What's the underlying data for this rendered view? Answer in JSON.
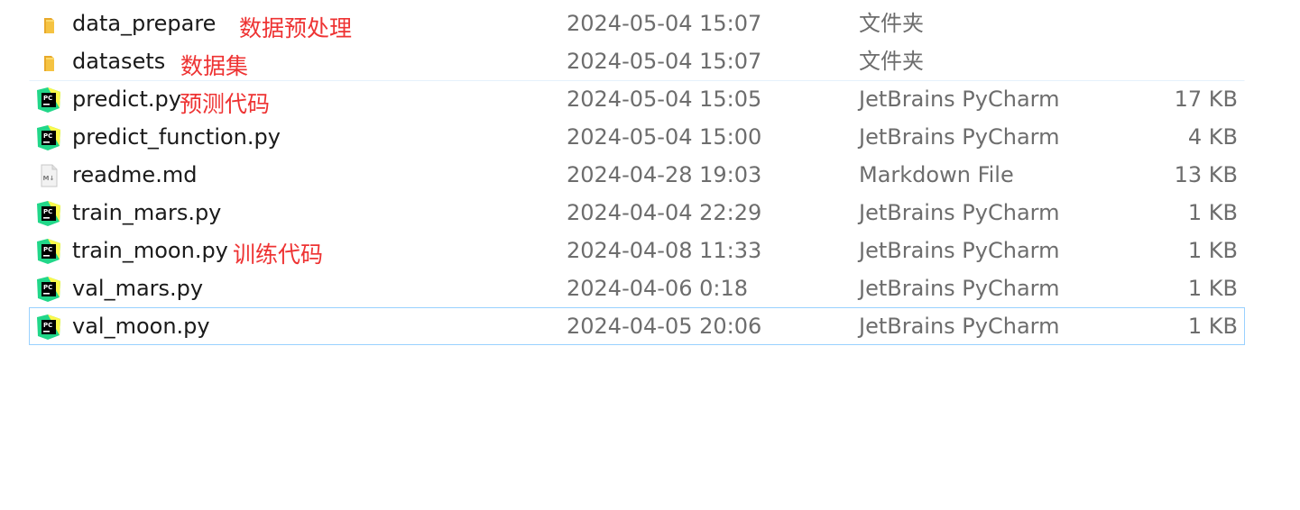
{
  "colors": {
    "annotation": "#ee3333",
    "selection_border": "#99d1ff",
    "folder": "#f5c342",
    "pycharm_green": "#21d789",
    "pycharm_yellow": "#fcf84a"
  },
  "files": [
    {
      "name": "data_prepare",
      "date": "2024-05-04 15:07",
      "type": "文件夹",
      "size": "",
      "icon": "folder-icon"
    },
    {
      "name": "datasets",
      "date": "2024-05-04 15:07",
      "type": "文件夹",
      "size": "",
      "icon": "folder-icon"
    },
    {
      "name": "predict.py",
      "date": "2024-05-04 15:05",
      "type": "JetBrains PyCharm",
      "size": "17 KB",
      "icon": "pycharm-file-icon"
    },
    {
      "name": "predict_function.py",
      "date": "2024-05-04 15:00",
      "type": "JetBrains PyCharm",
      "size": "4 KB",
      "icon": "pycharm-file-icon"
    },
    {
      "name": "readme.md",
      "date": "2024-04-28 19:03",
      "type": "Markdown File",
      "size": "13 KB",
      "icon": "markdown-file-icon"
    },
    {
      "name": "train_mars.py",
      "date": "2024-04-04 22:29",
      "type": "JetBrains PyCharm",
      "size": "1 KB",
      "icon": "pycharm-file-icon"
    },
    {
      "name": "train_moon.py",
      "date": "2024-04-08 11:33",
      "type": "JetBrains PyCharm",
      "size": "1 KB",
      "icon": "pycharm-file-icon"
    },
    {
      "name": "val_mars.py",
      "date": "2024-04-06 0:18",
      "type": "JetBrains PyCharm",
      "size": "1 KB",
      "icon": "pycharm-file-icon"
    },
    {
      "name": "val_moon.py",
      "date": "2024-04-05 20:06",
      "type": "JetBrains PyCharm",
      "size": "1 KB",
      "icon": "pycharm-file-icon"
    }
  ],
  "annotations": {
    "data_prepare": "数据预处理",
    "datasets": "数据集",
    "predict": "预测代码",
    "train": "训练代码"
  }
}
